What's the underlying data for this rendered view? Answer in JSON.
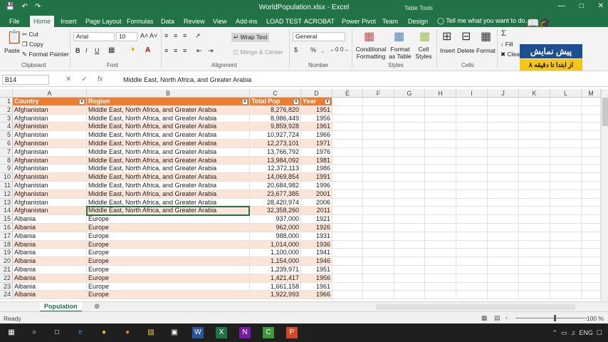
{
  "window": {
    "title": "WorldPopulation.xlsx - Excel",
    "context_tab": "Table Tools"
  },
  "tabs": [
    "File",
    "Home",
    "Insert",
    "Page Layout",
    "Formulas",
    "Data",
    "Review",
    "View",
    "Add-ins",
    "LOAD TEST",
    "ACROBAT",
    "Power Pivot",
    "Team",
    "Design"
  ],
  "active_tab": "Home",
  "tell_me": "Tell me what you want to do...",
  "ribbon": {
    "clipboard": {
      "paste": "Paste",
      "cut": "Cut",
      "copy": "Copy",
      "format_painter": "Format Painter",
      "label": "Clipboard"
    },
    "font": {
      "name": "Arial",
      "size": "10",
      "label": "Font"
    },
    "alignment": {
      "wrap": "Wrap Text",
      "merge": "Merge & Center",
      "label": "Alignment"
    },
    "number": {
      "format": "General",
      "label": "Number"
    },
    "styles": {
      "conditional": "Conditional Formatting",
      "format_table": "Format as Table",
      "cell_styles": "Cell Styles",
      "label": "Styles"
    },
    "cells": {
      "insert": "Insert",
      "delete": "Delete",
      "format": "Format",
      "label": "Cells"
    },
    "editing": {
      "fill": "Fill",
      "clear": "Clear"
    }
  },
  "watermark": {
    "line1": "پیش نمایش",
    "line2": "از ابتدا تا دقیقه ۸"
  },
  "formula_bar": {
    "name_box": "B14",
    "value": "Middle East, North Africa, and Greater Arabia"
  },
  "columns": [
    "A",
    "B",
    "C",
    "D",
    "E",
    "F",
    "G",
    "H",
    "I",
    "J",
    "K",
    "L",
    "M"
  ],
  "table_headers": [
    "Country",
    "Region",
    "Total Pop",
    "Year"
  ],
  "rows": [
    [
      "Afghanistan",
      "Middle East, North Africa, and Greater Arabia",
      "8,276,820",
      "1951"
    ],
    [
      "Afghanistan",
      "Middle East, North Africa, and Greater Arabia",
      "8,986,449",
      "1956"
    ],
    [
      "Afghanistan",
      "Middle East, North Africa, and Greater Arabia",
      "9,859,928",
      "1961"
    ],
    [
      "Afghanistan",
      "Middle East, North Africa, and Greater Arabia",
      "10,927,724",
      "1966"
    ],
    [
      "Afghanistan",
      "Middle East, North Africa, and Greater Arabia",
      "12,273,101",
      "1971"
    ],
    [
      "Afghanistan",
      "Middle East, North Africa, and Greater Arabia",
      "13,766,792",
      "1976"
    ],
    [
      "Afghanistan",
      "Middle East, North Africa, and Greater Arabia",
      "13,984,092",
      "1981"
    ],
    [
      "Afghanistan",
      "Middle East, North Africa, and Greater Arabia",
      "12,372,113",
      "1986"
    ],
    [
      "Afghanistan",
      "Middle East, North Africa, and Greater Arabia",
      "14,069,854",
      "1991"
    ],
    [
      "Afghanistan",
      "Middle East, North Africa, and Greater Arabia",
      "20,684,982",
      "1996"
    ],
    [
      "Afghanistan",
      "Middle East, North Africa, and Greater Arabia",
      "23,677,385",
      "2001"
    ],
    [
      "Afghanistan",
      "Middle East, North Africa, and Greater Arabia",
      "28,420,974",
      "2006"
    ],
    [
      "Afghanistan",
      "Middle East, North Africa, and Greater Arabia",
      "32,358,260",
      "2011"
    ],
    [
      "Albania",
      "Europe",
      "937,000",
      "1921"
    ],
    [
      "Albania",
      "Europe",
      "962,000",
      "1926"
    ],
    [
      "Albania",
      "Europe",
      "988,000",
      "1931"
    ],
    [
      "Albania",
      "Europe",
      "1,014,000",
      "1936"
    ],
    [
      "Albania",
      "Europe",
      "1,100,000",
      "1941"
    ],
    [
      "Albania",
      "Europe",
      "1,154,000",
      "1946"
    ],
    [
      "Albania",
      "Europe",
      "1,239,971",
      "1951"
    ],
    [
      "Albania",
      "Europe",
      "1,421,417",
      "1956"
    ],
    [
      "Albania",
      "Europe",
      "1,661,158",
      "1961"
    ],
    [
      "Albania",
      "Europe",
      "1,922,993",
      "1966"
    ]
  ],
  "selected_row_index": 12,
  "sheet_tab": "Population",
  "status": {
    "ready": "Ready",
    "zoom": "100 %"
  },
  "taskbar": {
    "lang": "ENG"
  }
}
